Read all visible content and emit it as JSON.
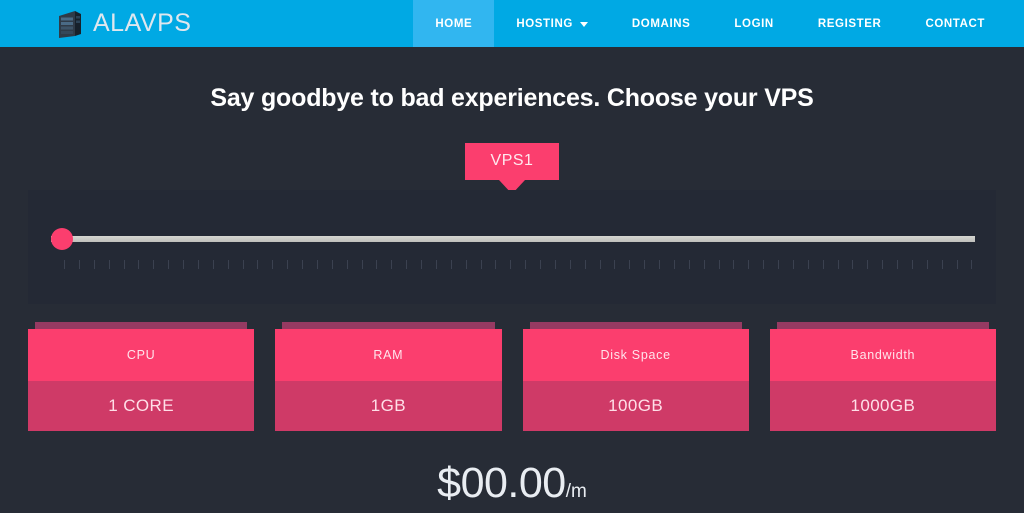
{
  "header": {
    "brand_name": "ALAVPS",
    "brand_icon": "server-rack-icon",
    "background_color": "#00a9e4",
    "active_color": "#31b6f0",
    "nav": [
      {
        "label": "HOME",
        "active": true,
        "has_dropdown": false
      },
      {
        "label": "HOSTING",
        "active": false,
        "has_dropdown": true
      },
      {
        "label": "DOMAINS",
        "active": false,
        "has_dropdown": false
      },
      {
        "label": "LOGIN",
        "active": false,
        "has_dropdown": false
      },
      {
        "label": "REGISTER",
        "active": false,
        "has_dropdown": false
      },
      {
        "label": "CONTACT",
        "active": false,
        "has_dropdown": false
      }
    ]
  },
  "main": {
    "headline": "Say goodbye to bad experiences. Choose your VPS",
    "background_color": "#272c36",
    "accent_color": "#fb3e6e",
    "slider": {
      "badge_label": "VPS1",
      "value": 0,
      "min": 0,
      "max": 100,
      "tick_count": 62,
      "panel_color": "#242935",
      "track_color": "#d6d6d2",
      "handle_color": "#fb3e6e"
    },
    "spec_cards": [
      {
        "title": "CPU",
        "value": "1 CORE"
      },
      {
        "title": "RAM",
        "value": "1GB"
      },
      {
        "title": "Disk Space",
        "value": "100GB"
      },
      {
        "title": "Bandwidth",
        "value": "1000GB"
      }
    ],
    "price": {
      "amount": "$00.00",
      "period": "/m"
    }
  }
}
